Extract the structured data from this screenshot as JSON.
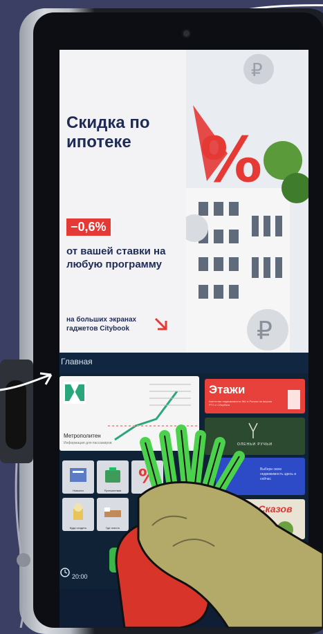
{
  "promo": {
    "title": "Скидка по ипотеке",
    "discount": "−0,6%",
    "subtitle": "от вашей ставки на любую программу",
    "footer": "на больших экранах гаджетов Citybook"
  },
  "nav": {
    "title": "Главная"
  },
  "tiles": {
    "metro": {
      "name": "Метрополитен",
      "sub": "Информация для пассажиров"
    },
    "etazhi": {
      "title": "Этажи",
      "sub": "Агентство недвижимости №1 в России по версии РТО и Сбербанк"
    },
    "ruchi": {
      "label": "ОЛЕНЬИ РУЧЬИ"
    },
    "blue": {
      "text": "Выбери свою недвижимость здесь и сейчас"
    },
    "fairy": {
      "label": "Парк Сказов"
    },
    "small": [
      "Новости",
      "Путешествия",
      "Куда сходить",
      "Где поесть"
    ]
  },
  "clock": {
    "time": "20:00"
  },
  "colors": {
    "accent_red": "#e53935",
    "navy": "#1e2b55",
    "screen_bg": "#0f2236"
  }
}
